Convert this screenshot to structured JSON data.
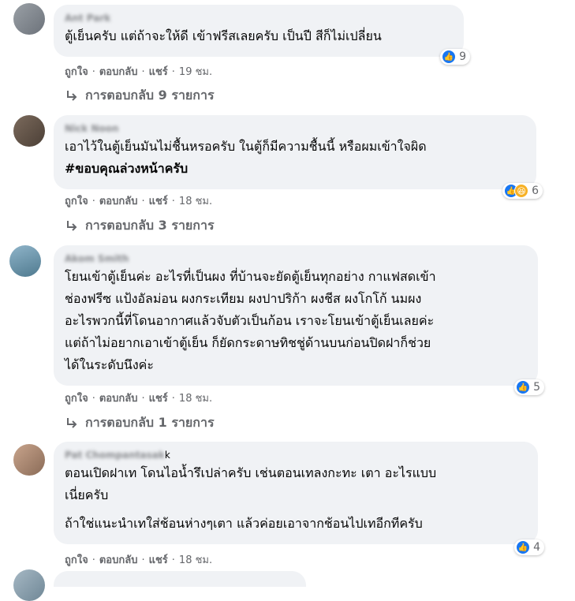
{
  "comments": [
    {
      "author": "Ant Park",
      "lines": [
        "ตู้เย็นครับ แต่ถ้าจะให้ดี เข้าฟรีสเลยครับ เป็นปี สีก็ไม่เปลี่ยน"
      ],
      "reactions": {
        "icons": [
          "like-icon"
        ],
        "count": "9"
      },
      "actions": {
        "like": "ถูกใจ",
        "reply": "ตอบกลับ",
        "share": "แชร์",
        "time": "19 ชม."
      },
      "replies_label": "การตอบกลับ 9 รายการ"
    },
    {
      "author": "Nick Noon",
      "lines": [
        "เอาไว้ในตู้เย็นมันไม่ชื้นหรอครับ ในตู้ก็มีความชื้นนี้ หรือผมเข้าใจผิด"
      ],
      "hashtag": "#ขอบคุณล่วงหน้าครับ",
      "reactions": {
        "icons": [
          "like-icon",
          "haha-icon"
        ],
        "count": "6"
      },
      "actions": {
        "like": "ถูกใจ",
        "reply": "ตอบกลับ",
        "share": "แชร์",
        "time": "18 ชม."
      },
      "replies_label": "การตอบกลับ 3 รายการ"
    },
    {
      "author": "Akom Smith",
      "lines": [
        "โยนเข้าตู้เย็นค่ะ อะไรที่เป็นผง ที่บ้านจะยัดตู้เย็นทุกอย่าง กาแฟสดเข้า",
        "ช่องฟรีซ แป้งอัลม่อน ผงกระเทียม ผงปาปริก้า ผงชีส ผงโกโก้ นมผง",
        "อะไรพวกนี้ที่โดนอากาศแล้วจับตัวเป็นก้อน เราจะโยนเข้าตู้เย็นเลยค่ะ",
        "แต่ถ้าไม่อยากเอาเข้าตู้เย็น ก็ยัดกระดาษทิชชู่ด้านบนก่อนปิดฝาก็ช่วย",
        "ได้ในระดับนึงค่ะ"
      ],
      "reactions": {
        "icons": [
          "like-icon"
        ],
        "count": "5"
      },
      "actions": {
        "like": "ถูกใจ",
        "reply": "ตอบกลับ",
        "share": "แชร์",
        "time": "18 ชม."
      },
      "replies_label": "การตอบกลับ 1 รายการ"
    },
    {
      "author": "Pat Chompantasak",
      "author_tail": "k",
      "lines": [
        "ตอนเปิดฝาเท โดนไอน้ำรึเปล่าครับ เช่นตอนเทลงกะทะ เตา อะไรแบบ",
        "เนี่ยครับ"
      ],
      "lines2": [
        "ถ้าใช่แนะนำเทใส่ช้อนห่างๆเตา แล้วค่อยเอาจากช้อนไปเทอีกทีครับ"
      ],
      "reactions": {
        "icons": [
          "like-icon"
        ],
        "count": "4"
      },
      "actions": {
        "like": "ถูกใจ",
        "reply": "ตอบกลับ",
        "share": "แชร์",
        "time": "18 ชม."
      }
    }
  ],
  "dot": "·",
  "colors": {
    "like": "#1877f2",
    "haha": "#f7b125",
    "bubble": "#f0f2f5",
    "meta": "#65676b"
  }
}
